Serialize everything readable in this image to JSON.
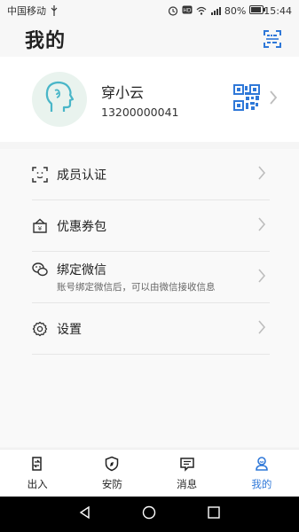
{
  "status": {
    "carrier": "中国移动",
    "battery": "80%",
    "time": "15:44"
  },
  "header": {
    "title": "我的",
    "scan_icon": "scan-icon"
  },
  "profile": {
    "name": "穿小云",
    "phone": "13200000041",
    "avatar_icon": "head-avatar-icon",
    "qr_icon": "qr-code-icon"
  },
  "menu": {
    "items": [
      {
        "label": "成员认证",
        "icon": "face-id-icon"
      },
      {
        "label": "优惠券包",
        "icon": "coupon-bag-icon"
      },
      {
        "label": "绑定微信",
        "sub": "账号绑定微信后，可以由微信接收信息",
        "icon": "wechat-icon"
      },
      {
        "label": "设置",
        "icon": "gear-icon"
      }
    ]
  },
  "tabs": [
    {
      "label": "出入",
      "icon": "door-icon"
    },
    {
      "label": "安防",
      "icon": "shield-icon"
    },
    {
      "label": "消息",
      "icon": "message-icon"
    },
    {
      "label": "我的",
      "icon": "user-icon",
      "active": true
    }
  ],
  "colors": {
    "accent": "#2f78d8",
    "avatar_bg": "#e9f3ee",
    "avatar_stroke": "#49b6c8"
  }
}
